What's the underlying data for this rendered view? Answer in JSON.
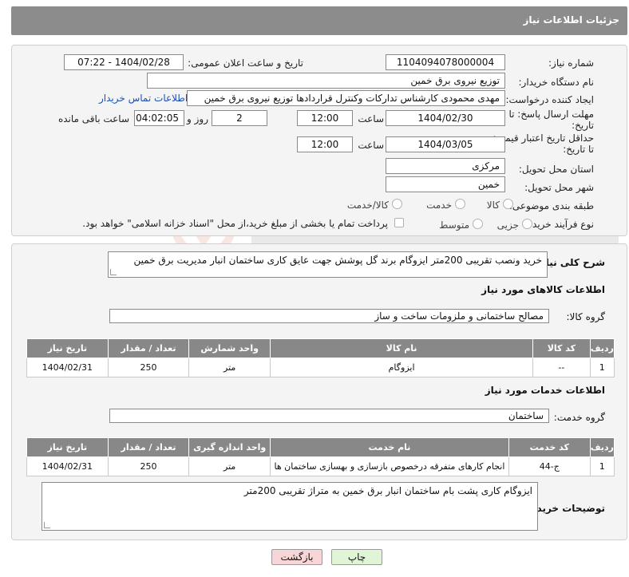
{
  "header": {
    "title": "جزئیات اطلاعات نیاز"
  },
  "form": {
    "need_number": {
      "label": "شماره نیاز:",
      "value": "1104094078000004"
    },
    "announce": {
      "label": "تاریخ و ساعت اعلان عمومی:",
      "value": "1404/02/28 - 07:22"
    },
    "buyer_org": {
      "label": "نام دستگاه خریدار:",
      "value": "توزیع نیروی برق خمین"
    },
    "creator": {
      "label": "ایجاد کننده درخواست:",
      "value": "مهدی محمودی کارشناس تدارکات وکنترل قراردادها توزیع نیروی برق خمین",
      "contact_link": "اطلاعات تماس خریدار"
    },
    "deadline": {
      "label_line1": "مهلت ارسال پاسخ: تا",
      "label_line2": "تاریخ:",
      "date": "1404/02/30",
      "time_label": "ساعت",
      "time": "12:00",
      "days": "2",
      "days_label": "روز و",
      "remaining": "04:02:05",
      "remaining_label": "ساعت باقی مانده"
    },
    "validity": {
      "label_line1": "حداقل تاریخ اعتبار قیمت:",
      "label_line2": "تا تاریخ:",
      "date": "1404/03/05",
      "time_label": "ساعت",
      "time": "12:00"
    },
    "province": {
      "label": "استان محل تحویل:",
      "value": "مرکزی"
    },
    "city": {
      "label": "شهر محل تحویل:",
      "value": "خمین"
    },
    "category": {
      "label": "طبقه بندی موضوعی:",
      "options": [
        "کالا",
        "خدمت",
        "کالا/خدمت"
      ]
    },
    "process": {
      "label": "نوع فرآیند خرید :",
      "options": [
        "جزیی",
        "متوسط"
      ],
      "payment_note": "پرداخت تمام یا بخشی از مبلغ خرید،از محل \"اسناد خزانه اسلامی\" خواهد بود."
    }
  },
  "description": {
    "label": "شرح کلی نیاز:",
    "value": "خرید ونصب تقریبی 200متر ایزوگام برند گل پوشش جهت عایق کاری ساختمان انبار مدیریت برق خمین"
  },
  "goods": {
    "section_title": "اطلاعات کالاهای مورد نیاز",
    "group_label": "گروه کالا:",
    "group_value": "مصالح ساختمانی و ملزومات ساخت و ساز",
    "columns": [
      "ردیف",
      "کد کالا",
      "نام کالا",
      "واحد شمارش",
      "تعداد / مقدار",
      "تاریخ نیاز"
    ],
    "rows": [
      [
        "1",
        "--",
        "ایزوگام",
        "متر",
        "250",
        "1404/02/31"
      ]
    ]
  },
  "services": {
    "section_title": "اطلاعات خدمات مورد نیاز",
    "group_label": "گروه خدمت:",
    "group_value": "ساختمان",
    "columns": [
      "ردیف",
      "کد خدمت",
      "نام خدمت",
      "واحد اندازه گیری",
      "تعداد / مقدار",
      "تاریخ نیاز"
    ],
    "rows": [
      [
        "1",
        "ج-44",
        "انجام کارهای متفرقه درخصوص بازسازی و بهسازی ساختمان ها",
        "متر",
        "250",
        "1404/02/31"
      ]
    ]
  },
  "buyer_notes": {
    "label": "توضیحات خریدار:",
    "value": "ایزوگام کاری پشت بام ساختمان انبار برق خمین به متراژ تقریبی 200متر"
  },
  "buttons": {
    "print": "چاپ",
    "back": "بازگشت"
  },
  "colors": {
    "header_bg": "#8c8c8c",
    "table_header_bg": "#888888",
    "link": "#1a4fb5",
    "print_btn": "#dff5d6",
    "back_btn": "#f6d6d6"
  }
}
